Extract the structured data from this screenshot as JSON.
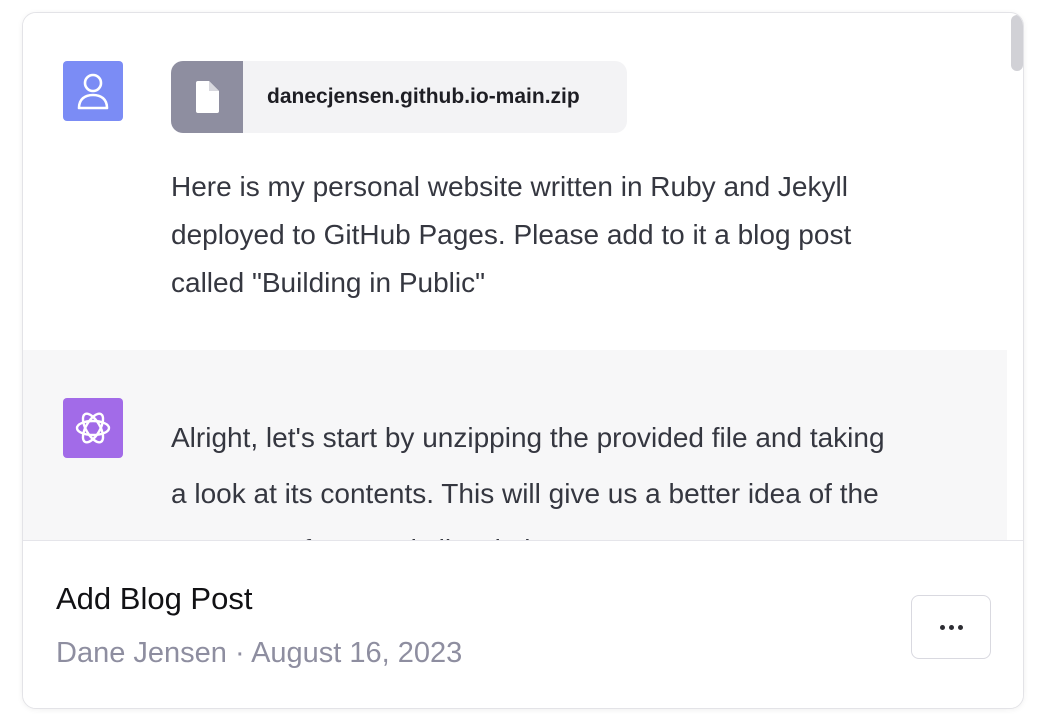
{
  "conversation": {
    "user_message": {
      "attachment": {
        "file_name": "danecjensen.github.io-main.zip",
        "icon": "file-icon"
      },
      "text": "Here is my personal website written in Ruby and Jekyll deployed to GitHub Pages.  Please add to it a blog post called \"Building in Public\"",
      "avatar_icon": "user-icon"
    },
    "assistant_message": {
      "text": "Alright, let's start by unzipping the provided file and taking a look at its contents. This will give us a better idea of the structure of your Jekyll website.",
      "avatar_icon": "openai-logo-icon"
    }
  },
  "footer": {
    "title": "Add Blog Post",
    "author": "Dane Jensen",
    "separator": " · ",
    "date": "August 16, 2023",
    "more_button_icon": "ellipsis-icon"
  },
  "colors": {
    "user_avatar": "#7b8cf5",
    "assistant_avatar": "#a26be8",
    "assistant_background": "#f7f7f8",
    "file_icon_background": "#8e8ea0"
  }
}
